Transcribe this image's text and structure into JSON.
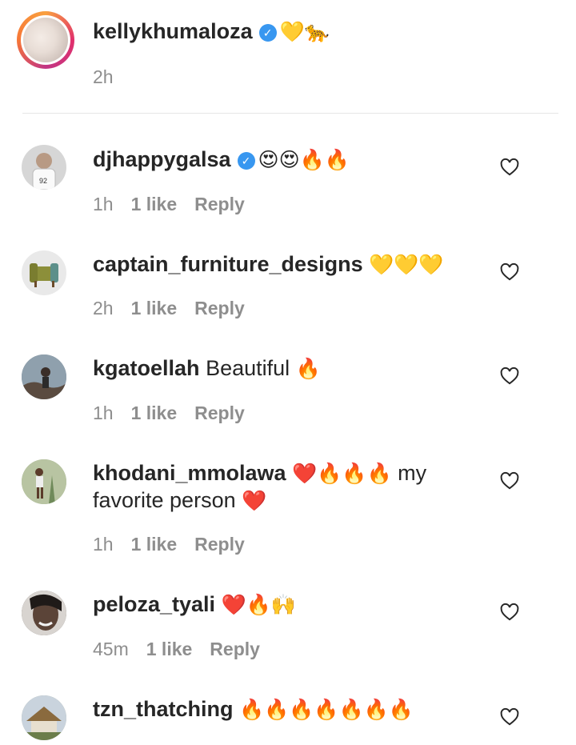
{
  "caption": {
    "username": "kellykhumaloza",
    "emojis": "💛🐆",
    "time": "2h"
  },
  "comments": [
    {
      "username": "djhappygalsa",
      "verified": true,
      "text": "",
      "emojis": "😍😍🔥🔥",
      "text2": "",
      "time": "1h",
      "likes": "1 like",
      "reply": "Reply",
      "avatar_color": "#cfcfcf"
    },
    {
      "username": "captain_furniture_designs",
      "verified": false,
      "text": "",
      "emojis": "💛💛💛",
      "text2": "",
      "time": "2h",
      "likes": "1 like",
      "reply": "Reply",
      "avatar_color": "#b7c0a8"
    },
    {
      "username": "kgatoellah",
      "verified": false,
      "text": "Beautiful",
      "emojis": "🔥",
      "text2": "",
      "time": "1h",
      "likes": "1 like",
      "reply": "Reply",
      "avatar_color": "#6e7a86"
    },
    {
      "username": "khodani_mmolawa",
      "verified": false,
      "text": "",
      "emojis": "❤️🔥🔥🔥",
      "text2": "my",
      "line2": "favorite person",
      "line2_emoji": "❤️",
      "time": "1h",
      "likes": "1 like",
      "reply": "Reply",
      "avatar_color": "#9aa58a"
    },
    {
      "username": "peloza_tyali",
      "verified": false,
      "text": "",
      "emojis": "❤️🔥🙌",
      "text2": "",
      "time": "45m",
      "likes": "1 like",
      "reply": "Reply",
      "avatar_color": "#5d5652"
    },
    {
      "username": "tzn_thatching",
      "verified": false,
      "text": "",
      "emojis": "🔥🔥🔥🔥🔥🔥🔥",
      "text2": "",
      "time": "",
      "likes": "",
      "reply": "",
      "avatar_color": "#8a8f7a"
    }
  ],
  "icons": {
    "verified": "verified-badge-icon",
    "like": "heart-outline-icon"
  },
  "colors": {
    "verified": "#3897f0",
    "meta": "#8e8e8e",
    "text": "#262626"
  }
}
